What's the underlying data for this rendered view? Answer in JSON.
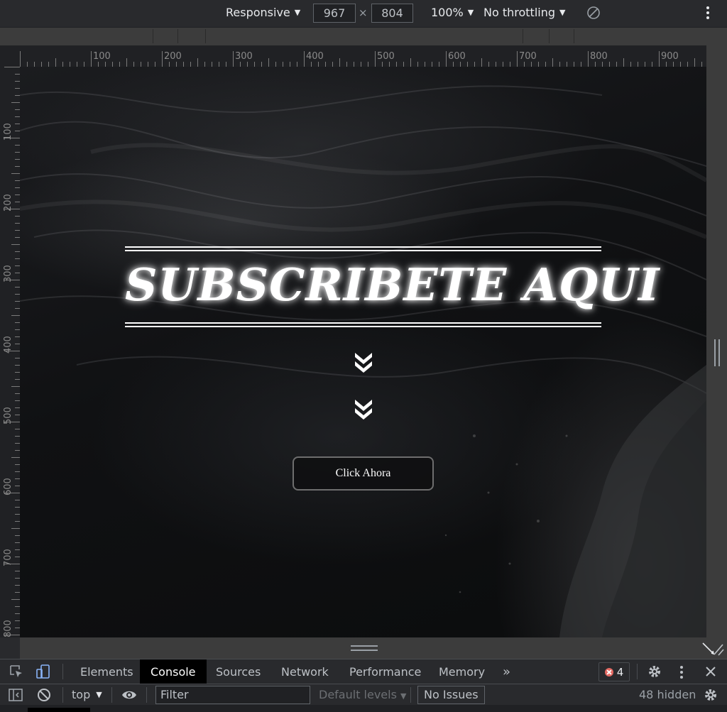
{
  "device_toolbar": {
    "device_mode": "Responsive",
    "width": "967",
    "height": "804",
    "dimension_separator": "×",
    "zoom": "100%",
    "throttling": "No throttling"
  },
  "rulers": {
    "horizontal": [
      "100",
      "200",
      "300",
      "400",
      "500",
      "600",
      "700",
      "800",
      "900"
    ],
    "vertical": [
      "100",
      "200",
      "300",
      "400",
      "500",
      "600",
      "700",
      "800"
    ]
  },
  "page": {
    "title": "SUBSCRIBETE AQUI",
    "cta_label": "Click Ahora",
    "colors": {
      "text": "#ffffff",
      "background": "#0f1012"
    }
  },
  "devtools": {
    "tabs": [
      "Elements",
      "Console",
      "Sources",
      "Network",
      "Performance",
      "Memory"
    ],
    "active_tab": "Console",
    "more_tabs_icon": "chevrons-right-icon",
    "error_count": "4",
    "console": {
      "context": "top",
      "filter_placeholder": "Filter",
      "levels": "Default levels",
      "issues": "No Issues",
      "hidden": "48 hidden"
    }
  }
}
